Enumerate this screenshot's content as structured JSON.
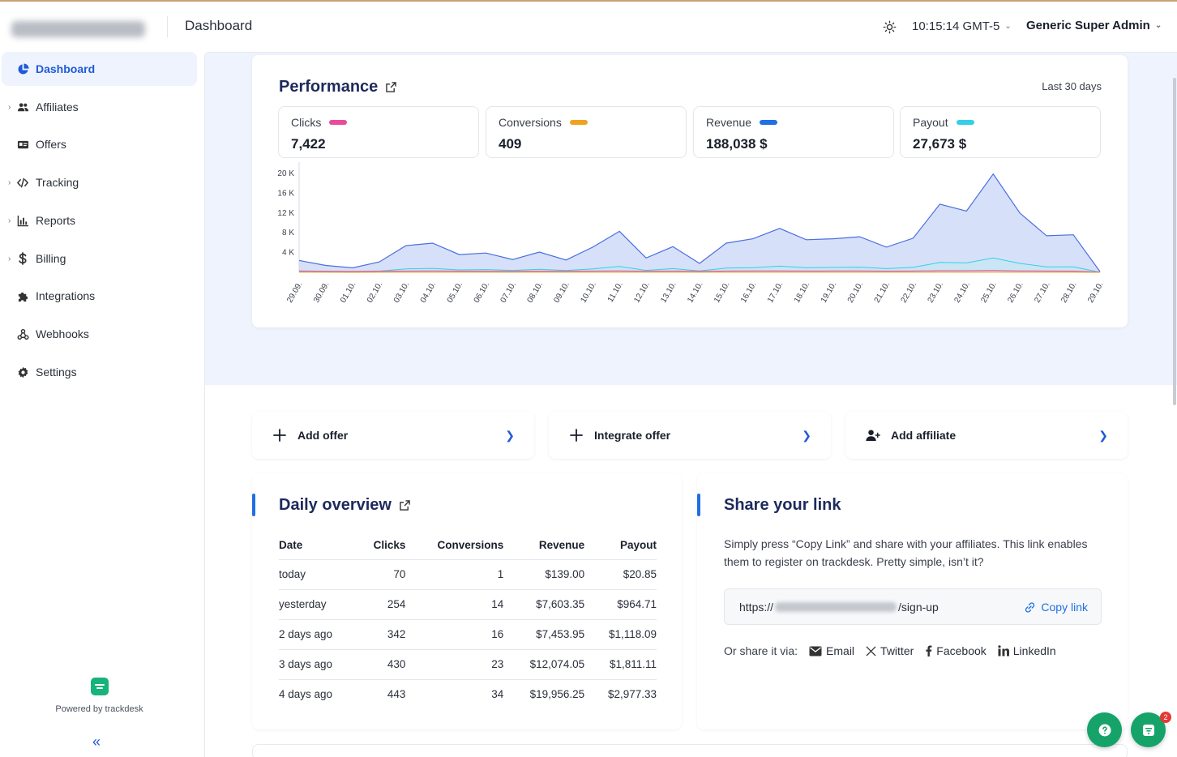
{
  "header": {
    "page_title": "Dashboard",
    "time": "10:15:14 GMT-5",
    "user": "Generic Super Admin"
  },
  "sidebar": {
    "items": [
      {
        "label": "Dashboard",
        "icon": "pie-chart-icon",
        "active": true,
        "expandable": false
      },
      {
        "label": "Affiliates",
        "icon": "users-icon",
        "active": false,
        "expandable": true
      },
      {
        "label": "Offers",
        "icon": "id-card-icon",
        "active": false,
        "expandable": false
      },
      {
        "label": "Tracking",
        "icon": "code-icon",
        "active": false,
        "expandable": true
      },
      {
        "label": "Reports",
        "icon": "bar-chart-icon",
        "active": false,
        "expandable": true
      },
      {
        "label": "Billing",
        "icon": "dollar-icon",
        "active": false,
        "expandable": true
      },
      {
        "label": "Integrations",
        "icon": "puzzle-icon",
        "active": false,
        "expandable": false
      },
      {
        "label": "Webhooks",
        "icon": "webhook-icon",
        "active": false,
        "expandable": false
      },
      {
        "label": "Settings",
        "icon": "gear-icon",
        "active": false,
        "expandable": false
      }
    ],
    "powered_by": "Powered by trackdesk"
  },
  "performance": {
    "title": "Performance",
    "range": "Last 30 days",
    "kpis": [
      {
        "label": "Clicks",
        "value": "7,422",
        "color": "#e84c9a"
      },
      {
        "label": "Conversions",
        "value": "409",
        "color": "#f0a21f"
      },
      {
        "label": "Revenue",
        "value": "188,038 $",
        "color": "#1f6fe5"
      },
      {
        "label": "Payout",
        "value": "27,673 $",
        "color": "#33d0e6"
      }
    ]
  },
  "chart_data": {
    "type": "area",
    "x": [
      "29.09.",
      "30.09.",
      "01.10.",
      "02.10.",
      "03.10.",
      "04.10.",
      "05.10.",
      "06.10.",
      "07.10.",
      "08.10.",
      "09.10.",
      "10.10.",
      "11.10.",
      "12.10.",
      "13.10.",
      "14.10.",
      "15.10.",
      "16.10.",
      "17.10.",
      "18.10.",
      "19.10.",
      "20.10.",
      "21.10.",
      "22.10.",
      "23.10.",
      "24.10.",
      "25.10.",
      "26.10.",
      "27.10.",
      "28.10.",
      "29.10."
    ],
    "y_ticks": [
      "4 K",
      "8 K",
      "12 K",
      "16 K",
      "20 K"
    ],
    "ylim": [
      0,
      21000
    ],
    "series": [
      {
        "name": "Revenue",
        "color": "#4a6fe0",
        "values": [
          2400,
          1400,
          900,
          2100,
          5400,
          5900,
          3600,
          3900,
          2600,
          4100,
          2500,
          5100,
          8300,
          2900,
          5200,
          1800,
          5900,
          6800,
          8900,
          6600,
          6800,
          7200,
          5100,
          6900,
          13800,
          12400,
          19900,
          12000,
          7400,
          7600,
          140
        ]
      },
      {
        "name": "Payout",
        "color": "#33d0e6",
        "values": [
          300,
          200,
          150,
          250,
          700,
          800,
          500,
          550,
          400,
          600,
          380,
          700,
          1200,
          400,
          750,
          300,
          850,
          950,
          1250,
          950,
          1000,
          1050,
          750,
          1000,
          2000,
          1900,
          2900,
          1800,
          1100,
          1100,
          20
        ]
      },
      {
        "name": "Clicks",
        "color": "#e84c9a",
        "values": [
          240,
          200,
          180,
          210,
          260,
          280,
          240,
          230,
          220,
          250,
          230,
          260,
          300,
          230,
          260,
          220,
          270,
          280,
          300,
          270,
          280,
          290,
          250,
          270,
          330,
          320,
          360,
          300,
          260,
          250,
          60
        ]
      },
      {
        "name": "Conversions",
        "color": "#f0a21f",
        "values": [
          14,
          10,
          8,
          12,
          18,
          20,
          14,
          14,
          12,
          15,
          12,
          16,
          22,
          12,
          16,
          10,
          18,
          20,
          22,
          18,
          19,
          20,
          16,
          18,
          26,
          24,
          34,
          23,
          16,
          14,
          1
        ]
      }
    ]
  },
  "quick_actions": [
    {
      "label": "Add offer",
      "icon": "plus-icon"
    },
    {
      "label": "Integrate offer",
      "icon": "plus-icon"
    },
    {
      "label": "Add affiliate",
      "icon": "user-plus-icon"
    }
  ],
  "daily": {
    "title": "Daily overview",
    "columns": [
      "Date",
      "Clicks",
      "Conversions",
      "Revenue",
      "Payout"
    ],
    "rows": [
      [
        "today",
        "70",
        "1",
        "$139.00",
        "$20.85"
      ],
      [
        "yesterday",
        "254",
        "14",
        "$7,603.35",
        "$964.71"
      ],
      [
        "2 days ago",
        "342",
        "16",
        "$7,453.95",
        "$1,118.09"
      ],
      [
        "3 days ago",
        "430",
        "23",
        "$12,074.05",
        "$1,811.11"
      ],
      [
        "4 days ago",
        "443",
        "34",
        "$19,956.25",
        "$2,977.33"
      ]
    ]
  },
  "share": {
    "title": "Share your link",
    "description": "Simply press “Copy Link” and share with your affiliates. This link enables them to register on trackdesk. Pretty simple, isn’t it?",
    "link_prefix": "https://",
    "link_suffix": "/sign-up",
    "copy_label": "Copy link",
    "via_label": "Or share it via:",
    "options": [
      {
        "label": "Email",
        "icon": "email-icon"
      },
      {
        "label": "Twitter",
        "icon": "x-twitter-icon"
      },
      {
        "label": "Facebook",
        "icon": "facebook-icon"
      },
      {
        "label": "LinkedIn",
        "icon": "linkedin-icon"
      }
    ]
  },
  "notifications": {
    "badge": "2"
  }
}
